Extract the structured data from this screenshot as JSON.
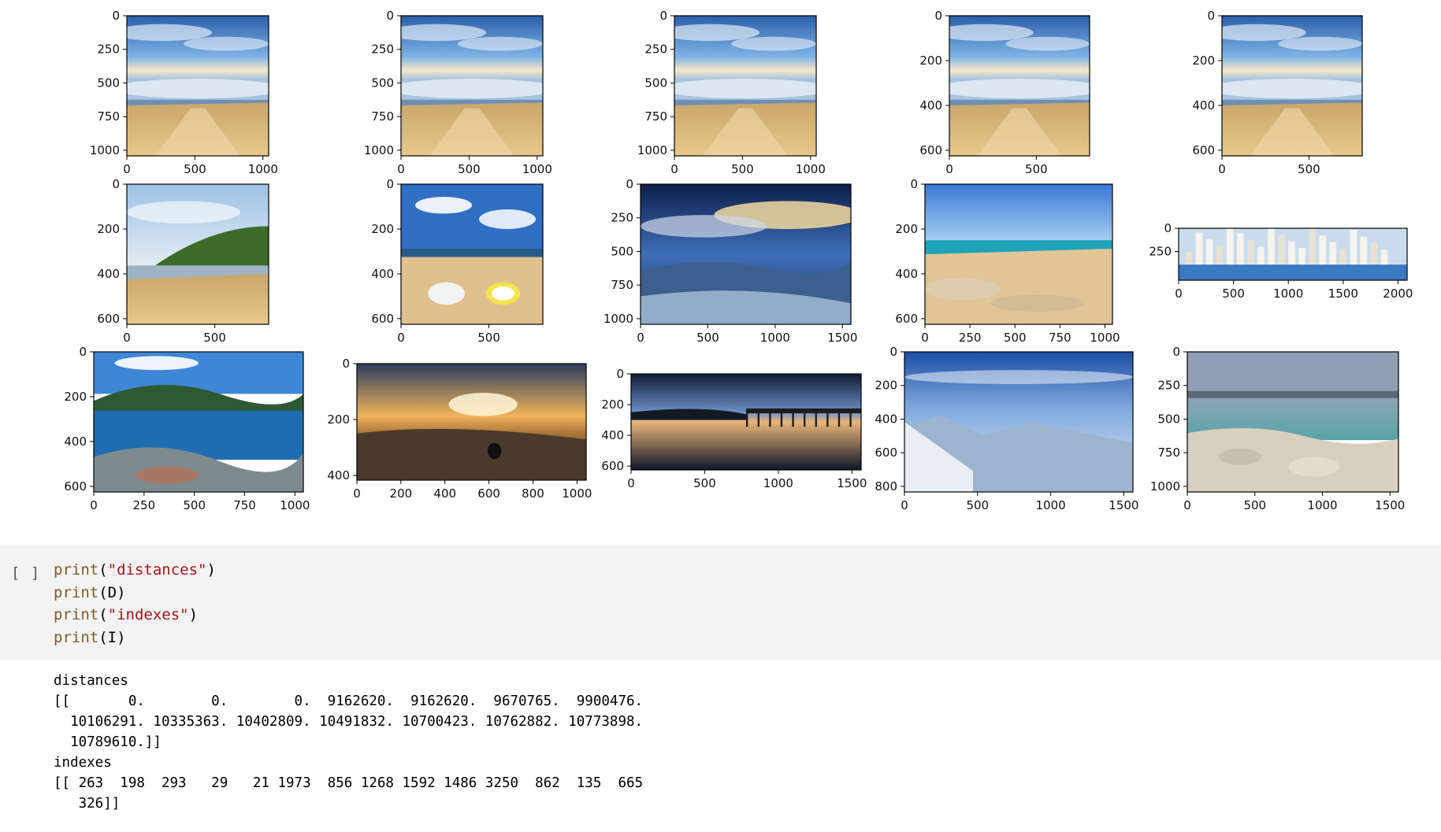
{
  "plots": [
    {
      "id": "p1",
      "scene": "beach-sky",
      "xticks": [
        "0",
        "500",
        "1000"
      ],
      "yticks": [
        "0",
        "250",
        "500",
        "750",
        "1000"
      ]
    },
    {
      "id": "p2",
      "scene": "beach-sky",
      "xticks": [
        "0",
        "500",
        "1000"
      ],
      "yticks": [
        "0",
        "250",
        "500",
        "750",
        "1000"
      ]
    },
    {
      "id": "p3",
      "scene": "beach-sky",
      "xticks": [
        "0",
        "500",
        "1000"
      ],
      "yticks": [
        "0",
        "250",
        "500",
        "750",
        "1000"
      ]
    },
    {
      "id": "p4",
      "scene": "beach-sky",
      "xticks": [
        "0",
        "500"
      ],
      "yticks": [
        "0",
        "200",
        "400",
        "600"
      ]
    },
    {
      "id": "p5",
      "scene": "beach-sky",
      "xticks": [
        "0",
        "500"
      ],
      "yticks": [
        "0",
        "200",
        "400",
        "600"
      ]
    },
    {
      "id": "p6",
      "scene": "beach-hill",
      "xticks": [
        "0",
        "500"
      ],
      "yticks": [
        "0",
        "200",
        "400",
        "600"
      ]
    },
    {
      "id": "p7",
      "scene": "surfboards",
      "xticks": [
        "0",
        "500"
      ],
      "yticks": [
        "0",
        "200",
        "400",
        "600"
      ]
    },
    {
      "id": "p8",
      "scene": "dramatic-clouds",
      "xticks": [
        "0",
        "500",
        "1000",
        "1500"
      ],
      "yticks": [
        "0",
        "250",
        "500",
        "750",
        "1000"
      ]
    },
    {
      "id": "p9",
      "scene": "sunny-beach",
      "xticks": [
        "0",
        "250",
        "500",
        "750",
        "1000"
      ],
      "yticks": [
        "0",
        "200",
        "400",
        "600"
      ]
    },
    {
      "id": "p10",
      "scene": "city-skyline",
      "xticks": [
        "0",
        "500",
        "1000",
        "1500",
        "2000"
      ],
      "yticks": [
        "0",
        "250"
      ]
    },
    {
      "id": "p11",
      "scene": "lake-rocks",
      "xticks": [
        "0",
        "250",
        "500",
        "750",
        "1000"
      ],
      "yticks": [
        "0",
        "200",
        "400",
        "600"
      ]
    },
    {
      "id": "p12",
      "scene": "sunset-hills",
      "xticks": [
        "0",
        "200",
        "400",
        "600",
        "800",
        "1000"
      ],
      "yticks": [
        "0",
        "200",
        "400"
      ]
    },
    {
      "id": "p13",
      "scene": "pier-reflection",
      "xticks": [
        "0",
        "500",
        "1000",
        "1500"
      ],
      "yticks": [
        "0",
        "200",
        "400",
        "600"
      ]
    },
    {
      "id": "p14",
      "scene": "snowy-mountain",
      "xticks": [
        "0",
        "500",
        "1000",
        "1500"
      ],
      "yticks": [
        "0",
        "200",
        "400",
        "600",
        "800"
      ]
    },
    {
      "id": "p15",
      "scene": "rocky-coast",
      "xticks": [
        "0",
        "500",
        "1000",
        "1500"
      ],
      "yticks": [
        "0",
        "250",
        "500",
        "750",
        "1000"
      ]
    }
  ],
  "cell": {
    "run_indicator": "[ ]",
    "code_lines": [
      {
        "fn": "print",
        "open": "(",
        "arg": "\"distances\"",
        "arg_type": "str",
        "close": ")"
      },
      {
        "fn": "print",
        "open": "(",
        "arg": "D",
        "arg_type": "pn",
        "close": ")"
      },
      {
        "fn": "print",
        "open": "(",
        "arg": "\"indexes\"",
        "arg_type": "str",
        "close": ")"
      },
      {
        "fn": "print",
        "open": "(",
        "arg": "I",
        "arg_type": "pn",
        "close": ")"
      }
    ]
  },
  "output": {
    "lines": [
      "distances",
      "[[       0.        0.        0.  9162620.  9162620.  9670765.  9900476.",
      "  10106291. 10335363. 10402809. 10491832. 10700423. 10762882. 10773898.",
      "  10789610.]]",
      "indexes",
      "[[ 263  198  293   29   21 1973  856 1268 1592 1486 3250  862  135  665",
      "   326]]"
    ]
  },
  "colors": {
    "cell_bg": "#f3f3f3",
    "code_fn": "#795e26",
    "code_str": "#a31515"
  }
}
